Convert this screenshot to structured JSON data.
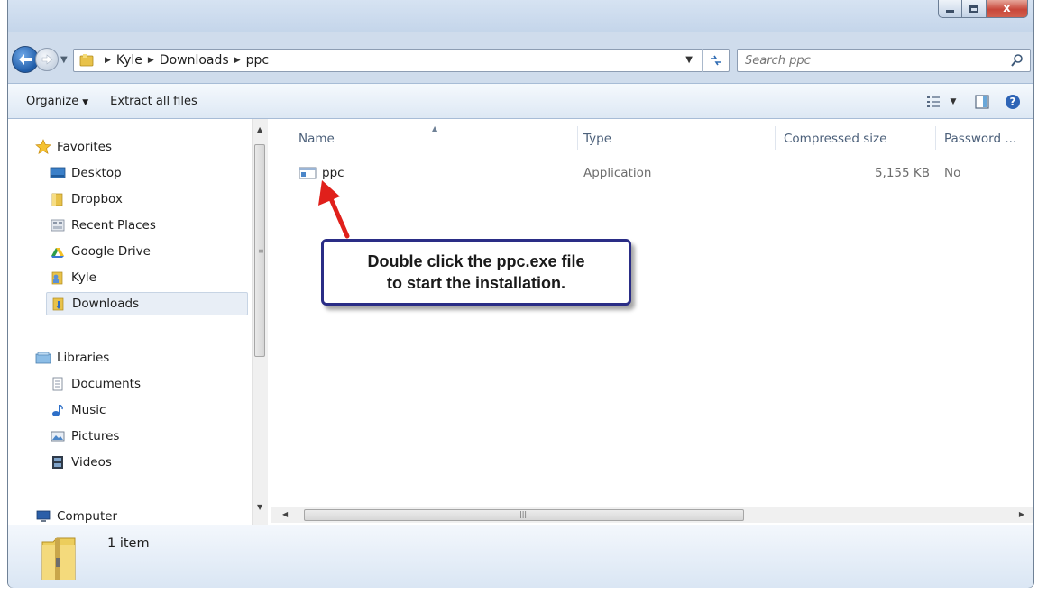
{
  "window": {
    "caption_buttons": {
      "minimize": "minimize",
      "maximize": "maximize",
      "close_label": "x"
    }
  },
  "address": {
    "breadcrumbs": [
      "Kyle",
      "Downloads",
      "ppc"
    ],
    "search_placeholder": "Search ppc"
  },
  "toolbar": {
    "organize_label": "Organize",
    "extract_label": "Extract all files"
  },
  "sidebar": {
    "favorites": {
      "label": "Favorites",
      "items": [
        {
          "label": "Desktop",
          "icon": "desktop-icon"
        },
        {
          "label": "Dropbox",
          "icon": "folder-icon"
        },
        {
          "label": "Recent Places",
          "icon": "recent-places-icon"
        },
        {
          "label": "Google Drive",
          "icon": "google-drive-icon"
        },
        {
          "label": "Kyle",
          "icon": "user-folder-icon"
        },
        {
          "label": "Downloads",
          "icon": "downloads-icon",
          "selected": true
        }
      ]
    },
    "libraries": {
      "label": "Libraries",
      "items": [
        {
          "label": "Documents",
          "icon": "document-icon"
        },
        {
          "label": "Music",
          "icon": "music-icon"
        },
        {
          "label": "Pictures",
          "icon": "pictures-icon"
        },
        {
          "label": "Videos",
          "icon": "videos-icon"
        }
      ]
    },
    "computer": {
      "label": "Computer"
    }
  },
  "file_list": {
    "columns": [
      "Name",
      "Type",
      "Compressed size",
      "Password ..."
    ],
    "rows": [
      {
        "name": "ppc",
        "type": "Application",
        "size": "5,155 KB",
        "password": "No"
      }
    ]
  },
  "callout": {
    "line1": "Double click the ppc.exe file",
    "line2": "to start the installation.",
    "border_color": "#2a2d86",
    "arrow_color": "#e0201b"
  },
  "details": {
    "count": "1 item"
  }
}
